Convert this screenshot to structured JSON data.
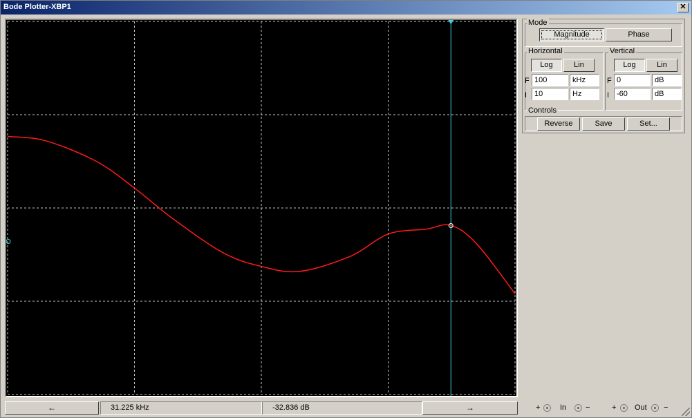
{
  "window": {
    "title": "Bode Plotter-XBP1",
    "close_glyph": "✕"
  },
  "mode": {
    "label": "Mode",
    "magnitude": "Magnitude",
    "phase": "Phase",
    "selected": "Magnitude"
  },
  "horizontal": {
    "label": "Horizontal",
    "log": "Log",
    "lin": "Lin",
    "selected": "Log",
    "final_letter": "F",
    "final_value": "100",
    "final_unit": "kHz",
    "initial_letter": "I",
    "initial_value": "10",
    "initial_unit": "Hz"
  },
  "vertical": {
    "label": "Vertical",
    "log": "Log",
    "lin": "Lin",
    "selected": "Log",
    "final_letter": "F",
    "final_value": "0",
    "final_unit": "dB",
    "initial_letter": "I",
    "initial_value": "-60",
    "initial_unit": "dB"
  },
  "controls": {
    "label": "Controls",
    "reverse": "Reverse",
    "save": "Save",
    "set": "Set..."
  },
  "readout": {
    "left_arrow": "←",
    "right_arrow": "→",
    "frequency": "31.225 kHz",
    "magnitude": "-32.836 dB"
  },
  "terminals": {
    "plus": "+",
    "minus": "−",
    "in_label": "In",
    "out_label": "Out"
  },
  "colors": {
    "trace": "#ff1a1a",
    "cursor": "#40d0e0",
    "grid": "#c8c8c8",
    "background": "#000000"
  },
  "chart_data": {
    "type": "line",
    "x_scale": "log",
    "xlim": [
      10,
      100000
    ],
    "ylim": [
      -60,
      0
    ],
    "grid": true,
    "cursor": {
      "x": 31225,
      "y": -32.836
    },
    "series": [
      {
        "x": [
          10,
          20,
          50,
          100,
          200,
          500,
          1000,
          2000,
          5000,
          10000,
          20000,
          31225,
          50000,
          100000
        ],
        "y": [
          -18.5,
          -19.2,
          -22.5,
          -26.8,
          -31.7,
          -37.2,
          -39.4,
          -40.2,
          -37.8,
          -34.2,
          -33.4,
          -32.8,
          -35.8,
          -43.8
        ]
      }
    ]
  }
}
